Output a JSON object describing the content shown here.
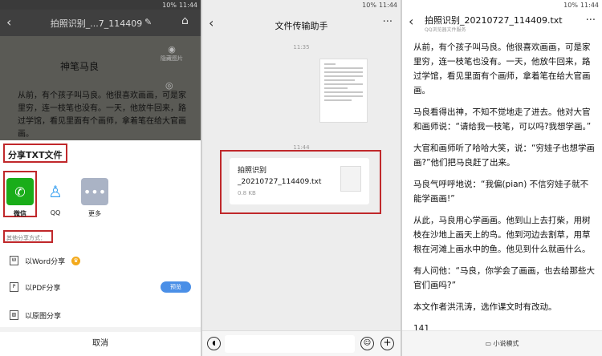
{
  "status": {
    "battery": "10%",
    "time": "11:44"
  },
  "screen1": {
    "title": "拍照识别_...7_114409",
    "book_title": "神笔马良",
    "book_text": "从前，有个孩子叫马良。他很喜欢画画，可是家里穷，连一枝笔也没有。一天，他放牛回来，路过学馆，看见里面有个画师，拿着笔在给大官画画。",
    "side1": "隐藏图片",
    "side2": "",
    "share_title": "分享TXT文件",
    "apps": [
      {
        "label": "微信"
      },
      {
        "label": "QQ"
      },
      {
        "label": "更多"
      }
    ],
    "other_methods": "其他分享方式：",
    "options": [
      {
        "label": "以Word分享"
      },
      {
        "label": "以PDF分享"
      },
      {
        "label": "以原图分享"
      }
    ],
    "preview_label": "预览",
    "cancel_label": "取消"
  },
  "screen2": {
    "title": "文件传输助手",
    "time1": "11:35",
    "time2": "11:44",
    "file_name": "拍照识别_20210727_114409.txt",
    "file_size": "0.8 KB"
  },
  "screen3": {
    "title": "拍照识别_20210727_114409.txt",
    "subtitle": "QQ浏览器文件服务",
    "paragraphs": [
      "从前，有个孩子叫马良。他很喜欢画画，可是家里穷，连一枝笔也没有。一天，他放牛回来，路过学馆，看见里面有个画师，拿着笔在给大官画画。",
      "马良看得出神，不知不觉地走了进去。他对大官和画师说：“请给我一枝笔，可以吗?我想学画。”",
      "大官和画师听了哈哈大笑，说：“穷娃子也想学画画?”他们把马良赶了出来。",
      "马良气呼呼地说：“我偏(pian) 不信穷娃子就不能学画画!”",
      "从此，马良用心学画画。他到山上去打柴，用树枝在沙地上画天上的鸟。他到河边去割草，用草根在河滩上画水中的鱼。他见到什么就画什么。",
      "有人问他：“马良，你学会了画画，也去给那些大官们画吗?”",
      "本文作者洪汛涛，选作课文时有改动。",
      "141"
    ],
    "mode_label": "小说模式"
  }
}
